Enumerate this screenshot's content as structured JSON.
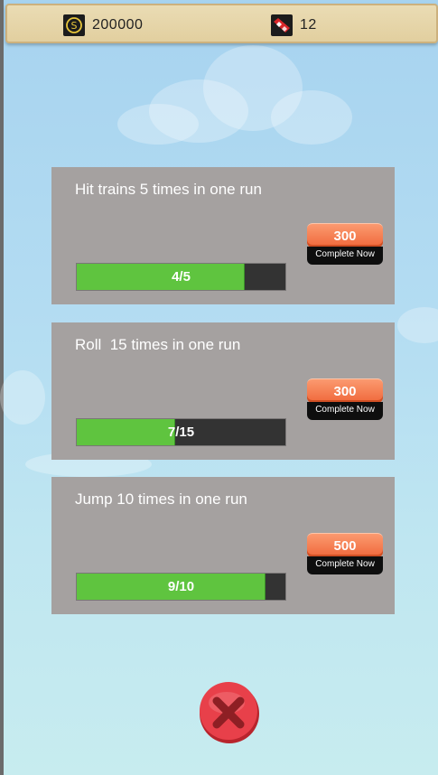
{
  "header": {
    "coins_icon": "coin-icon",
    "coins": "200000",
    "tickets_icon": "ticket-icon",
    "tickets": "12"
  },
  "missions": [
    {
      "title": "Hit trains 5 times in one run",
      "progress_text": "4/5",
      "progress_fraction": 0.8,
      "reward": "300",
      "action_label": "Complete Now"
    },
    {
      "title": "Roll  15 times in one run",
      "progress_text": "7/15",
      "progress_fraction": 0.4667,
      "reward": "300",
      "action_label": "Complete Now"
    },
    {
      "title": "Jump 10 times in one run",
      "progress_text": "9/10",
      "progress_fraction": 0.9,
      "reward": "500",
      "action_label": "Complete Now"
    }
  ],
  "close_icon": "close-x-icon",
  "colors": {
    "progress_fill": "#5fc43f",
    "progress_track": "#333333",
    "reward_button": "#f0683a",
    "card_bg": "#a5a1a0",
    "close_button": "#e8404a"
  }
}
